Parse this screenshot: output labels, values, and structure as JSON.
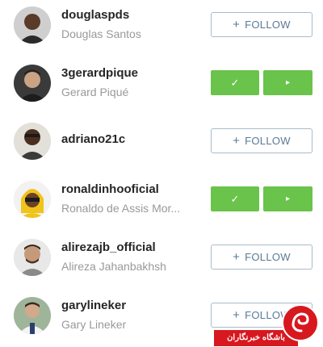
{
  "accounts": [
    {
      "username": "douglaspds",
      "full_name": "Douglas Santos",
      "following": false
    },
    {
      "username": "3gerardpique",
      "full_name": "Gerard Piqué",
      "following": true
    },
    {
      "username": "adriano21c",
      "full_name": "",
      "following": false
    },
    {
      "username": "ronaldinhooficial",
      "full_name": "Ronaldo de Assis Mor...",
      "following": true
    },
    {
      "username": "alirezajb_official",
      "full_name": "Alireza Jahanbakhsh",
      "following": false
    },
    {
      "username": "garylineker",
      "full_name": "Gary Lineker",
      "following": false
    }
  ],
  "buttons": {
    "follow_label": "FOLLOW",
    "follow_plus": "+",
    "following_check": "✓",
    "more_arrow": "▸"
  },
  "watermark": {
    "text": "باشگاه خبرنگاران"
  },
  "colors": {
    "following_green": "#6ac34b",
    "follow_border": "#a9bcc9",
    "follow_text": "#5a7a95",
    "username": "#262626",
    "full_name": "#999999",
    "watermark_red": "#d7181f"
  },
  "icons": {
    "following": "check-icon",
    "more": "play-arrow-icon",
    "avatar": "user-avatar-photo",
    "watermark": "news-agency-logo"
  }
}
